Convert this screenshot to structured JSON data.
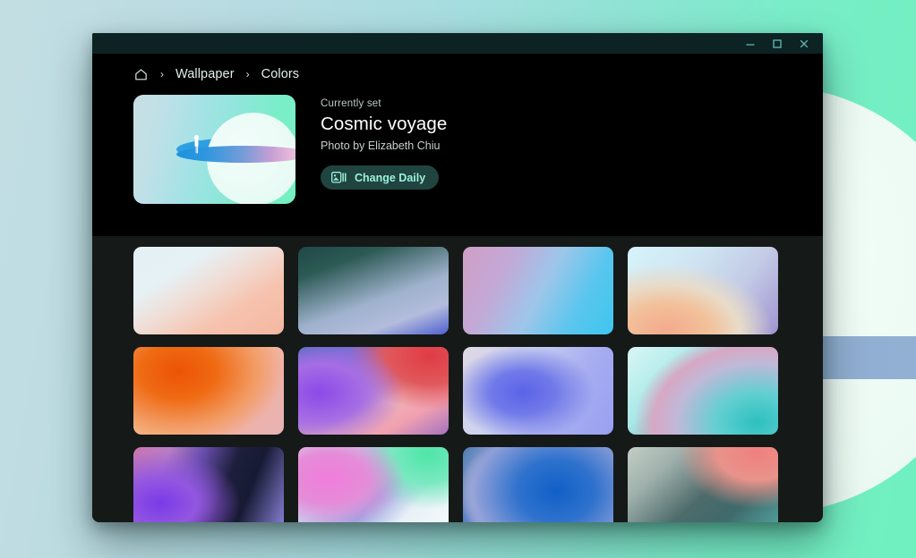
{
  "window": {
    "controls": [
      {
        "name": "minimize-button",
        "glyph": "minimize"
      },
      {
        "name": "maximize-button",
        "glyph": "maximize"
      },
      {
        "name": "close-button",
        "glyph": "close"
      }
    ]
  },
  "breadcrumb": {
    "home_icon": "home-icon",
    "separator": "›",
    "items": [
      {
        "label": "Wallpaper"
      },
      {
        "label": "Colors"
      }
    ]
  },
  "hero": {
    "thumbnail_alt": "Cosmic voyage wallpaper preview",
    "currently_set_label": "Currently set",
    "title": "Cosmic voyage",
    "author": "Photo by Elizabeth Chiu",
    "change_daily_label": "Change Daily",
    "change_daily_icon": "slideshow-icon"
  },
  "colors": {
    "desktop_bg_start": "#c3dee3",
    "desktop_bg_end": "#6ff0bf",
    "titlebar_bg": "#0c2223",
    "hero_bg": "#000000",
    "grid_bg": "#151918",
    "accent": "#9bf0dd",
    "button_bg": "#20443f",
    "text_primary": "#ffffff",
    "text_secondary": "#c5d0ce"
  },
  "grid": {
    "tiles": [
      {
        "name": "wallpaper-tile-1",
        "css": "linear-gradient(148deg,#e4f0f4 0%,#e6f1f5 28%,#f0ddd6 48%,#f6c3ae 70%,#f4b7a0 100%), radial-gradient(120% 90% at 78% 8%, #f3c0ae 0%, #e9cfd6 34%, rgba(226,240,245,0) 66%)"
      },
      {
        "name": "wallpaper-tile-2",
        "css": "linear-gradient(160deg,#1f4747 0%,#2d5a55 22%,#9fb2cd 58%,#b3bcdc 78%,#4f5fd0 100%), radial-gradient(90% 80% at 30% 6%, #17393a 0%, rgba(23,57,58,0) 62%)"
      },
      {
        "name": "wallpaper-tile-3",
        "css": "linear-gradient(118deg,#cf9fc4 0%,#c4a8d6 26%,#9dc6ea 52%,#59c6ee 76%,#3ec5ef 100%)"
      },
      {
        "name": "wallpaper-tile-4",
        "css": "radial-gradient(110% 120% at 26% 96%, #f4a98d 0%, #f2c19a 26%, #e8dcc9 44%, rgba(210,223,236,0) 64%), linear-gradient(128deg,#d6f3fb 0%,#cfe6f2 34%,#c3cbe6 66%,#9f93cf 100%)"
      },
      {
        "name": "wallpaper-tile-5",
        "css": "radial-gradient(90% 110% at 30% 28%, #ec5305 0%, #ef6a13 28%, #f29a62 56%, rgba(244,178,150,0) 78%), linear-gradient(128deg,#fbd297 0%,#f7bb8e 40%,#f0b3a6 72%,#e7b3b4 100%)"
      },
      {
        "name": "wallpaper-tile-6",
        "css": "radial-gradient(85% 95% at 14% 52%, #8b4ae8 0%, #a66de4 34%, rgba(200,140,220,0) 66%), radial-gradient(80% 90% at 88% 10%, #e03c44 0%, #e0585c 36%, rgba(224,100,105,0) 68%), linear-gradient(150deg,#3f6fb5 0%,#7b6fd6 26%,#f0b6b8 60%,#f0a0b0 78%,#a472c0 100%)"
      },
      {
        "name": "wallpaper-tile-7",
        "css": "radial-gradient(72% 82% at 40% 52%, #5a63e8 0%, #717ae9 30%, rgba(150,158,235,0) 66%), linear-gradient(118deg,#ded8e4 0%,#ccd2ee 34%,#a8aef0 68%,#9a9ff2 100%)"
      },
      {
        "name": "wallpaper-tile-8",
        "css": "radial-gradient(95% 120% at 86% 86%, #2cc0bd 0%, #62cfd2 28%, #bfb9d8 56%, #d7a8c4 72%, rgba(215,168,196,0) 86%), linear-gradient(136deg,#d9f6f4 0%,#a9e9e8 34%,#7fa8b8 62%,#6f9fb4 100%)"
      },
      {
        "name": "wallpaper-tile-9",
        "css": "radial-gradient(86% 96% at 18% 64%, #7a3ae8 0%, #9356e0 28%, rgba(160,110,220,0) 62%), linear-gradient(112deg,#c775b0 0%,#b97dc4 20%,#6b4fb0 38%,#1d1f3c 58%,#161a33 72%,#8f86e0 100%)"
      },
      {
        "name": "wallpaper-tile-10",
        "css": "radial-gradient(80% 90% at 20% 36%, #f07ddc 0%, #e58cd8 32%, rgba(220,160,215,0) 64%), radial-gradient(70% 90% at 86% 8%, #4ee5a6 0%, #7ae9c2 36%, rgba(140,232,206,0) 70%), linear-gradient(132deg,#dfe0f2 0%,#c9cdee 30%,#9aa2e0 54%,#e8f1f6 74%,#f4fbfd 100%)"
      },
      {
        "name": "wallpaper-tile-11",
        "css": "radial-gradient(86% 120% at 62% 50%, #1060c8 0%, #2f72cd 30%, #8f9fd8 62%, rgba(168,160,214,0) 82%), radial-gradient(36% 86% at 19% 52%, #f2f0cb 0%, #e8d6d2 30%, rgba(232,214,210,0) 58%), linear-gradient(140deg,#4d7fa8 0%,#4470bf 34%,#6f7ec9 62%,#a18ec8 100%)"
      },
      {
        "name": "wallpaper-tile-12",
        "css": "radial-gradient(78% 94% at 86% 6%, #f08080 0%, #e8938b 34%, rgba(200,150,145,0) 68%), linear-gradient(138deg,#c3cec6 0%,#9fb0ab 24%,#4e6b6b 52%,#3f6a6b 72%,#54a8a4 100%)"
      }
    ]
  }
}
